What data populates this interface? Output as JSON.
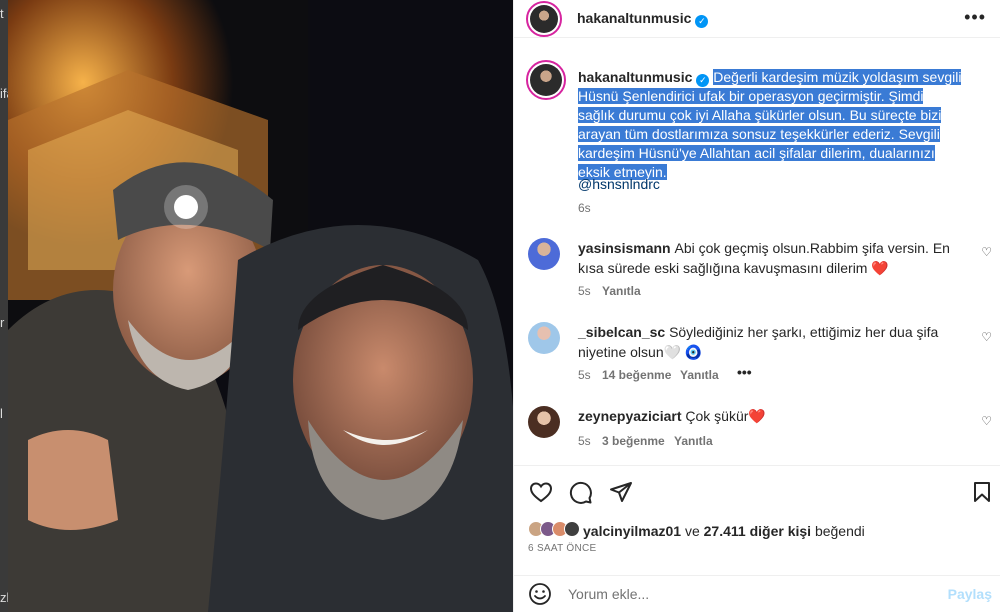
{
  "backdrop": {
    "fragments": [
      "t",
      "ifa",
      "r",
      "l",
      "zl"
    ]
  },
  "post": {
    "username": "hakanaltunmusic",
    "more_label": "•••",
    "caption": "Değerli kardeşim müzik yoldaşım sevgili Hüsnü Şenlendirici ufak bir operasyon geçirmiştir. Şimdi sağlık durumu çok iyi Allaha şükürler olsun. Bu süreçte bizi arayan tüm dostlarımıza sonsuz teşekkürler ederiz. Sevgili kardeşim Hüsnü'ye Allahtan acil şifalar dilerim, dualarınızı eksik etmeyin.",
    "mention": "@hsnsnlndrc",
    "caption_time": "6s"
  },
  "comments": [
    {
      "user": "yasinsismann",
      "text": "Abi çok geçmiş olsun.Rabbim şifa versin. En kısa sürede eski sağlığına kavuşmasını dilerim ❤️",
      "time": "5s",
      "likes": "",
      "reply": "Yanıtla"
    },
    {
      "user": "_sibelcan_sc",
      "text": "Söylediğiniz her şarkı, ettiğimiz her dua şifa niyetine olsun🤍 🧿",
      "time": "5s",
      "likes": "14 beğenme",
      "reply": "Yanıtla",
      "more": "•••"
    },
    {
      "user": "zeynepyaziciart",
      "text": "Çok şükür❤️",
      "time": "5s",
      "likes": "3 beğenme",
      "reply": "Yanıtla"
    }
  ],
  "likes": {
    "user": "yalcinyilmaz01",
    "connector": "ve",
    "count": "27.411 diğer kişi",
    "suffix": "beğendi"
  },
  "post_time": "6 SAAT ÖNCE",
  "comment_box": {
    "placeholder": "Yorum ekle...",
    "post_label": "Paylaş",
    "emoji_icon": "smiley-icon"
  },
  "colors": {
    "verified": "#0095f6",
    "highlight": "#3a7bd5",
    "link": "#00376b"
  }
}
